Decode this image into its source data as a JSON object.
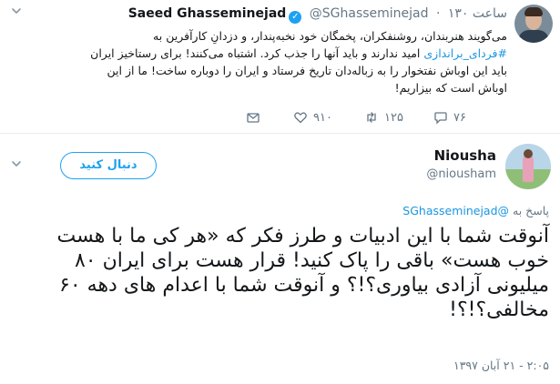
{
  "quoted_tweet": {
    "author_name": "Saeed Ghasseminejad",
    "verified_glyph": "✓",
    "handle": "@SGhasseminejad",
    "separator": "·",
    "time": "۱۳۰ ساعت",
    "text_part1": "می‌گویند هنربندان، روشنفکران، پخمگان خود نخبه‌پندار، و دزدانِ کارآفرین به ",
    "hashtag": "#فردای_براندازی",
    "text_part2": " امید ندارند و باید آنها را جذب کرد. اشتباه می‌کنند! برای رستاخیز ایران باید این اوباش نفتخوار را به زباله‌دان تاریخ فرستاد و ایران را دوباره ساخت! ما از این اوباش است که بیزاریم!",
    "actions": {
      "reply_count": "۷۶",
      "retweet_count": "۱۲۵",
      "like_count": "۹۱۰"
    },
    "icons": {
      "chevron": "chevron-down-icon",
      "reply": "reply-icon",
      "retweet": "retweet-icon",
      "like": "heart-icon",
      "dm": "envelope-icon"
    }
  },
  "main_tweet": {
    "author_name": "Niousha",
    "handle": "@niousham",
    "follow_label": "دنبال کنید",
    "reply_prefix": "پاسخ به ",
    "reply_mention": "@SGhasseminejad",
    "text": "آنوقت شما با این ادبیات و طرز فکر که «هر کی ما با هست خوب هست» باقی را پاک کنید! قرار هست برای ایران ۸۰ میلیونی آزادی بیاوری؟!؟ و آنوقت شما با اعدام های دهه ۶۰ مخالفی؟!؟!",
    "timestamp": "۲:۰۵ - ۲۱ آبان ۱۳۹۷"
  },
  "colors": {
    "accent": "#1da1f2",
    "link": "#1b95e0",
    "muted": "#657786",
    "text": "#14171a",
    "divider": "#e6ecf0"
  }
}
